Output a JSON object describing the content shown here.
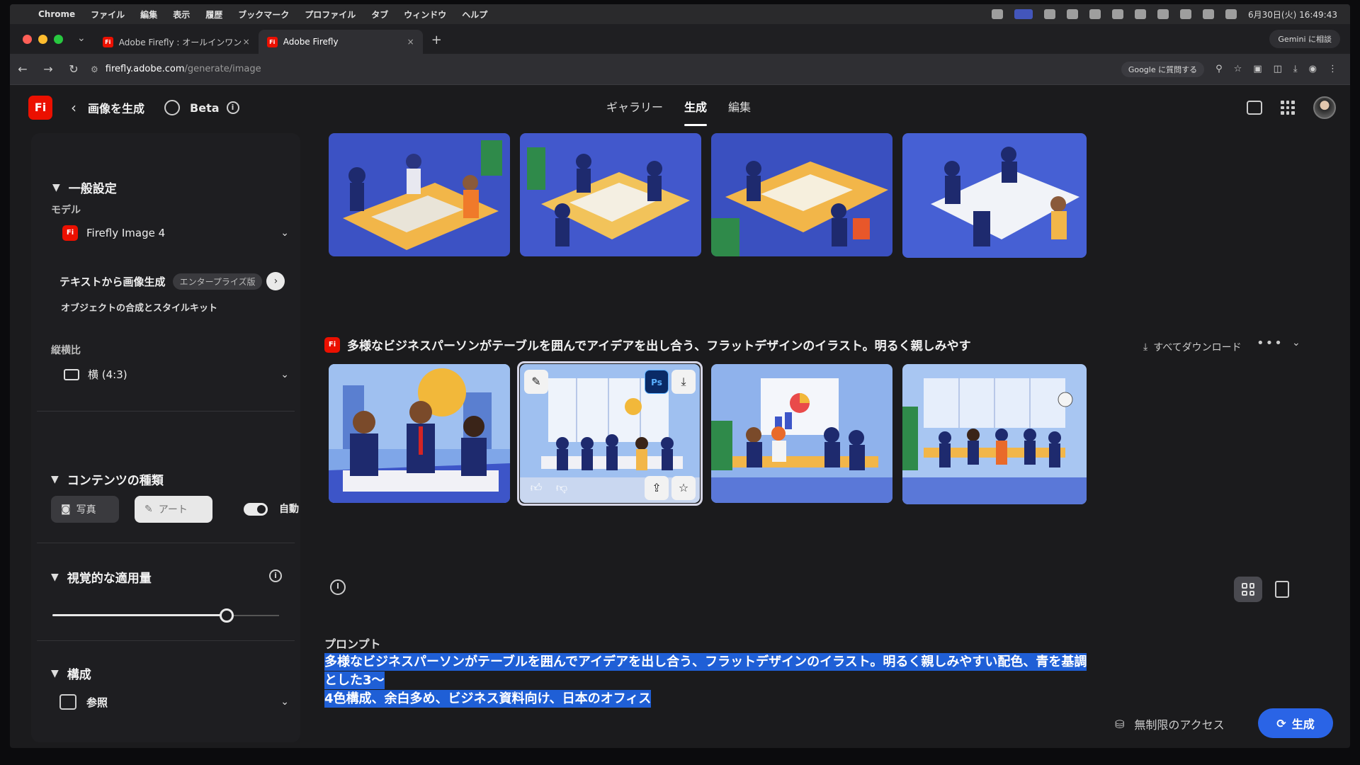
{
  "menubar": {
    "app": "Chrome",
    "items": [
      "ファイル",
      "編集",
      "表示",
      "履歴",
      "ブックマーク",
      "プロファイル",
      "タブ",
      "ウィンドウ",
      "ヘルプ"
    ],
    "clock": "6月30日(火) 16:49:43"
  },
  "browser": {
    "tabs": [
      {
        "label": "Adobe Firefly : オールインワン",
        "close": "×"
      },
      {
        "label": "Adobe Firefly",
        "close": "×"
      }
    ],
    "new_tab": "+",
    "gemini": "Gemini に相談",
    "url_host": "firefly.adobe.com",
    "url_path": "/generate/image",
    "google_search": "Google に質問する"
  },
  "app": {
    "logo": "Fi",
    "page_title": "画像を生成",
    "beta_label": "Beta",
    "nav": [
      "ギャラリー",
      "生成",
      "編集"
    ],
    "nav_active": "生成"
  },
  "sidebar": {
    "general_title": "一般設定",
    "model_label": "モデル",
    "model_value": "Firefly Image 4",
    "model_badge": "Fi",
    "t2i_label": "テキストから画像生成",
    "enterprise_badge": "エンタープライズ版",
    "t2i_sub": "オブジェクトの合成とスタイルキット",
    "aspect_label": "縦横比",
    "aspect_value": "横 (4:3)",
    "content_title": "コンテンツの種類",
    "photo_label": "写真",
    "art_label": "アート",
    "auto_label": "自動",
    "visual_title": "視覚的な適用量",
    "visual_value": 0.77,
    "compose_title": "構成",
    "reference_label": "参照"
  },
  "main": {
    "prompt_badge": "Fi",
    "prompt_heading": "多様なビジネスパーソンがテーブルを囲んでアイデアを出し合う、フラットデザインのイラスト。明るく親しみやす",
    "download_all": "すべてダウンロード",
    "more": "•••",
    "ps_label": "Ps",
    "prompt_section_label": "プロンプト",
    "prompt_line1": "多様なビジネスパーソンがテーブルを囲んでアイデアを出し合う、フラットデザインのイラスト。明るく親しみやすい配色、青を基調とした3〜",
    "prompt_line2": "4色構成、余白多め、ビジネス資料向け、日本のオフィス",
    "unlimited_label": "無制限のアクセス",
    "generate_label": "生成"
  },
  "colors": {
    "accent": "#2a64e6",
    "brand": "#eb1000",
    "image_blue": "#3d55c8",
    "table_yellow": "#f0b545"
  }
}
